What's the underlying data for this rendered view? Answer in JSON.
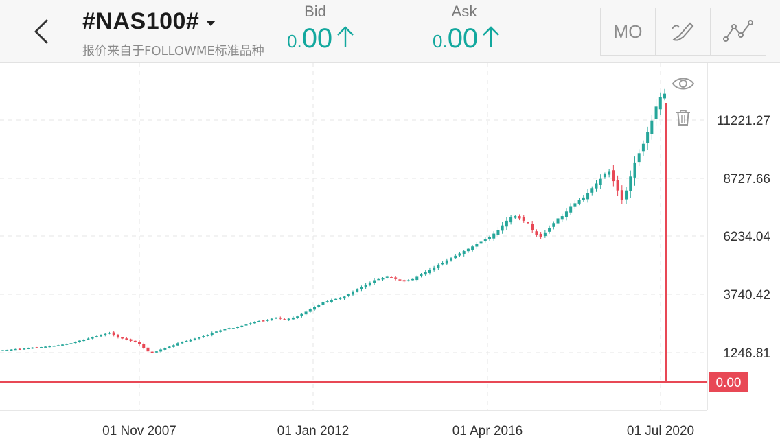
{
  "header": {
    "symbol": "#NAS100#",
    "subtitle": "报价来自于FOLLOWME标准品种",
    "bid": {
      "label": "Bid",
      "prefix": "0.",
      "value": "00",
      "direction": "up"
    },
    "ask": {
      "label": "Ask",
      "prefix": "0.",
      "value": "00",
      "direction": "up"
    },
    "tools": [
      {
        "label": "MO"
      },
      {
        "icon": "brush-icon"
      },
      {
        "icon": "line-tool-icon"
      }
    ]
  },
  "colors": {
    "up": "#26a69a",
    "down": "#e84855",
    "accent": "#13a89e",
    "price_line": "#e84855"
  },
  "chart_data": {
    "type": "candlestick",
    "y_ticks": [
      "11221.27",
      "8727.66",
      "6234.04",
      "3740.42",
      "1246.81"
    ],
    "x_ticks": [
      "01 Nov 2007",
      "01 Jan 2012",
      "01 Apr 2016",
      "01 Jul 2020"
    ],
    "current_price_label": "0.00",
    "grid": true,
    "series_closes": [
      1350,
      1360,
      1380,
      1400,
      1390,
      1420,
      1440,
      1460,
      1450,
      1480,
      1500,
      1520,
      1540,
      1560,
      1590,
      1620,
      1650,
      1700,
      1760,
      1800,
      1850,
      1900,
      1950,
      2000,
      2050,
      2100,
      2000,
      1900,
      1850,
      1800,
      1750,
      1700,
      1600,
      1450,
      1300,
      1250,
      1300,
      1380,
      1450,
      1500,
      1560,
      1650,
      1700,
      1750,
      1800,
      1850,
      1900,
      1950,
      2000,
      2100,
      2150,
      2200,
      2250,
      2300,
      2300,
      2350,
      2400,
      2450,
      2500,
      2550,
      2600,
      2620,
      2650,
      2700,
      2750,
      2700,
      2650,
      2700,
      2750,
      2800,
      2900,
      3000,
      3100,
      3200,
      3300,
      3400,
      3450,
      3500,
      3550,
      3600,
      3650,
      3750,
      3850,
      3950,
      4050,
      4150,
      4250,
      4350,
      4400,
      4450,
      4500,
      4450,
      4400,
      4350,
      4300,
      4350,
      4400,
      4500,
      4600,
      4700,
      4800,
      4900,
      5000,
      5100,
      5200,
      5300,
      5400,
      5500,
      5600,
      5700,
      5800,
      5900,
      6000,
      6100,
      6200,
      6350,
      6500,
      6700,
      6900,
      7050,
      7100,
      7000,
      6900,
      6800,
      6500,
      6300,
      6200,
      6400,
      6600,
      6800,
      7000,
      7100,
      7300,
      7500,
      7650,
      7800,
      7900,
      8100,
      8300,
      8500,
      8700,
      8900,
      9000,
      8600,
      8200,
      7800,
      8200,
      8800,
      9400,
      9800,
      10200,
      10700,
      11200,
      11800,
      12200,
      12350
    ]
  }
}
